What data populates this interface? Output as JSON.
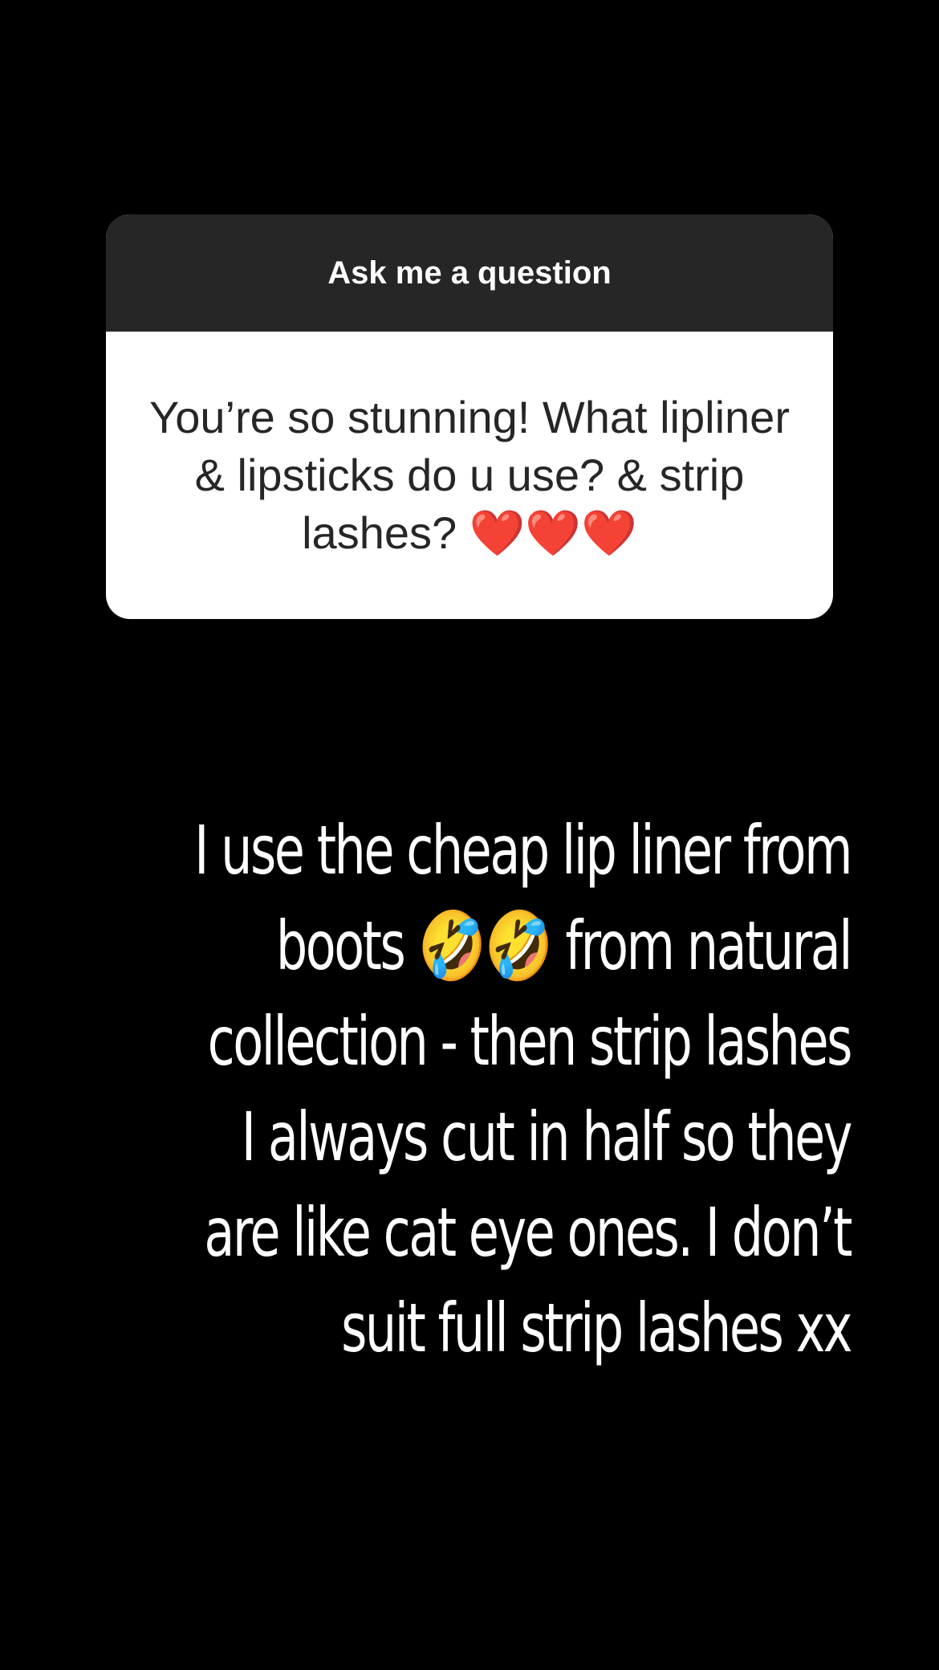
{
  "colors": {
    "background": "#000000",
    "card_header": "#262626",
    "card_body": "#ffffff",
    "question_text": "#262626",
    "answer_text": "#ffffff"
  },
  "question_sticker": {
    "header": "Ask me a question",
    "question": "You’re so stunning! What lipliner & lipsticks do u use? & strip lashes? ❤️❤️❤️"
  },
  "answer": {
    "text": "I use the cheap lip liner from boots 🤣🤣 from natural collection -  then strip lashes I always cut in half so they are like cat eye ones. I don’t suit full strip lashes xx"
  }
}
